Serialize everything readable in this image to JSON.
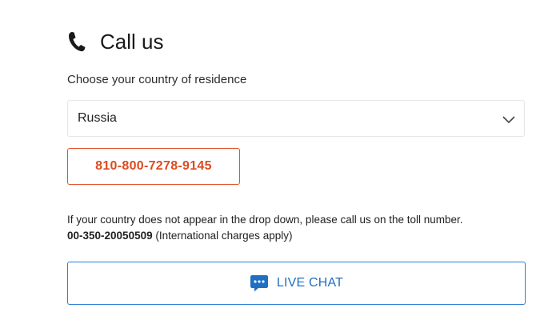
{
  "header": {
    "icon": "phone-icon",
    "title": "Call us"
  },
  "country": {
    "prompt": "Choose your country of residence",
    "selected": "Russia",
    "icon": "chevron-down-icon"
  },
  "phone": {
    "number": "810-800-7278-9145",
    "color": "#de4a1f"
  },
  "note": {
    "text": "If your country does not appear in the drop down, please call us on the toll number.",
    "toll_number": "00-350-20050509",
    "charges": " (International charges apply)"
  },
  "chat": {
    "icon": "chat-bubble-icon",
    "label": "LIVE CHAT",
    "color": "#1f6fc2"
  }
}
